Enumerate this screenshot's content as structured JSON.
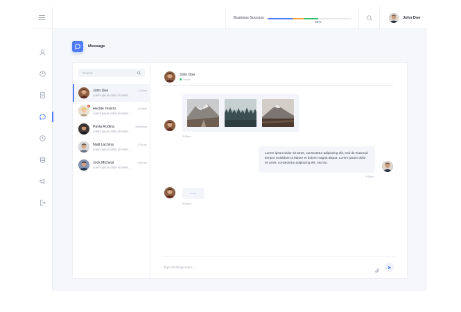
{
  "colors": {
    "accent": "#4f7cf7",
    "online": "#2dc26b",
    "notification": "#f0552a"
  },
  "topbar": {
    "progress_label": "Business Success",
    "progress_value": "60%",
    "progress_fraction": 0.6,
    "user_name": "John Doe",
    "search_icon": "search-icon",
    "menu_icon": "hamburger-menu-icon"
  },
  "sidebar": {
    "items": [
      {
        "icon": "user-icon"
      },
      {
        "icon": "clock-icon"
      },
      {
        "icon": "document-icon"
      },
      {
        "icon": "chat-icon",
        "active": true
      },
      {
        "icon": "time-icon"
      },
      {
        "icon": "database-icon"
      },
      {
        "icon": "megaphone-icon"
      },
      {
        "icon": "logout-icon"
      }
    ]
  },
  "page": {
    "title": "Message",
    "badge_icon": "chat-icon"
  },
  "contacts": {
    "search_placeholder": "Search",
    "items": [
      {
        "name": "John Doe",
        "preview": "Lorem ipsum dolor sit amet...",
        "time": "1:53pm",
        "active": true
      },
      {
        "name": "Heckie Terenti",
        "preview": "Lorem ipsum dolor sit amet...",
        "time": "8:05pm",
        "badge": "2"
      },
      {
        "name": "Pavla Rodina",
        "preview": "Lorem ipsum dolor sit amet...",
        "time": "yesterday"
      },
      {
        "name": "Niall Lachina",
        "preview": "Lorem ipsum dolor sit amet...",
        "time": "27th jan"
      },
      {
        "name": "Jock Micheal",
        "preview": "Lorem ipsum dolor sit amet...",
        "time": "26th jan"
      }
    ]
  },
  "chat": {
    "contact_name": "John Doe",
    "status": "Online",
    "messages": [
      {
        "direction": "in",
        "type": "photos",
        "time": "5:45pm"
      },
      {
        "direction": "out",
        "type": "text",
        "text": "Lorem ipsum dolor sit amet, consectetur adipiscing elit, sed do eiusmod tempor incididunt ut labore et dolore magna aliqua. Lorem ipsum dolor sit amet, consectetur adipiscing elit, sed do.",
        "time": "5:45pm"
      },
      {
        "direction": "in",
        "type": "typing",
        "text": "...",
        "time": "5:45pm"
      }
    ],
    "composer_placeholder": "Type Message Here..."
  }
}
